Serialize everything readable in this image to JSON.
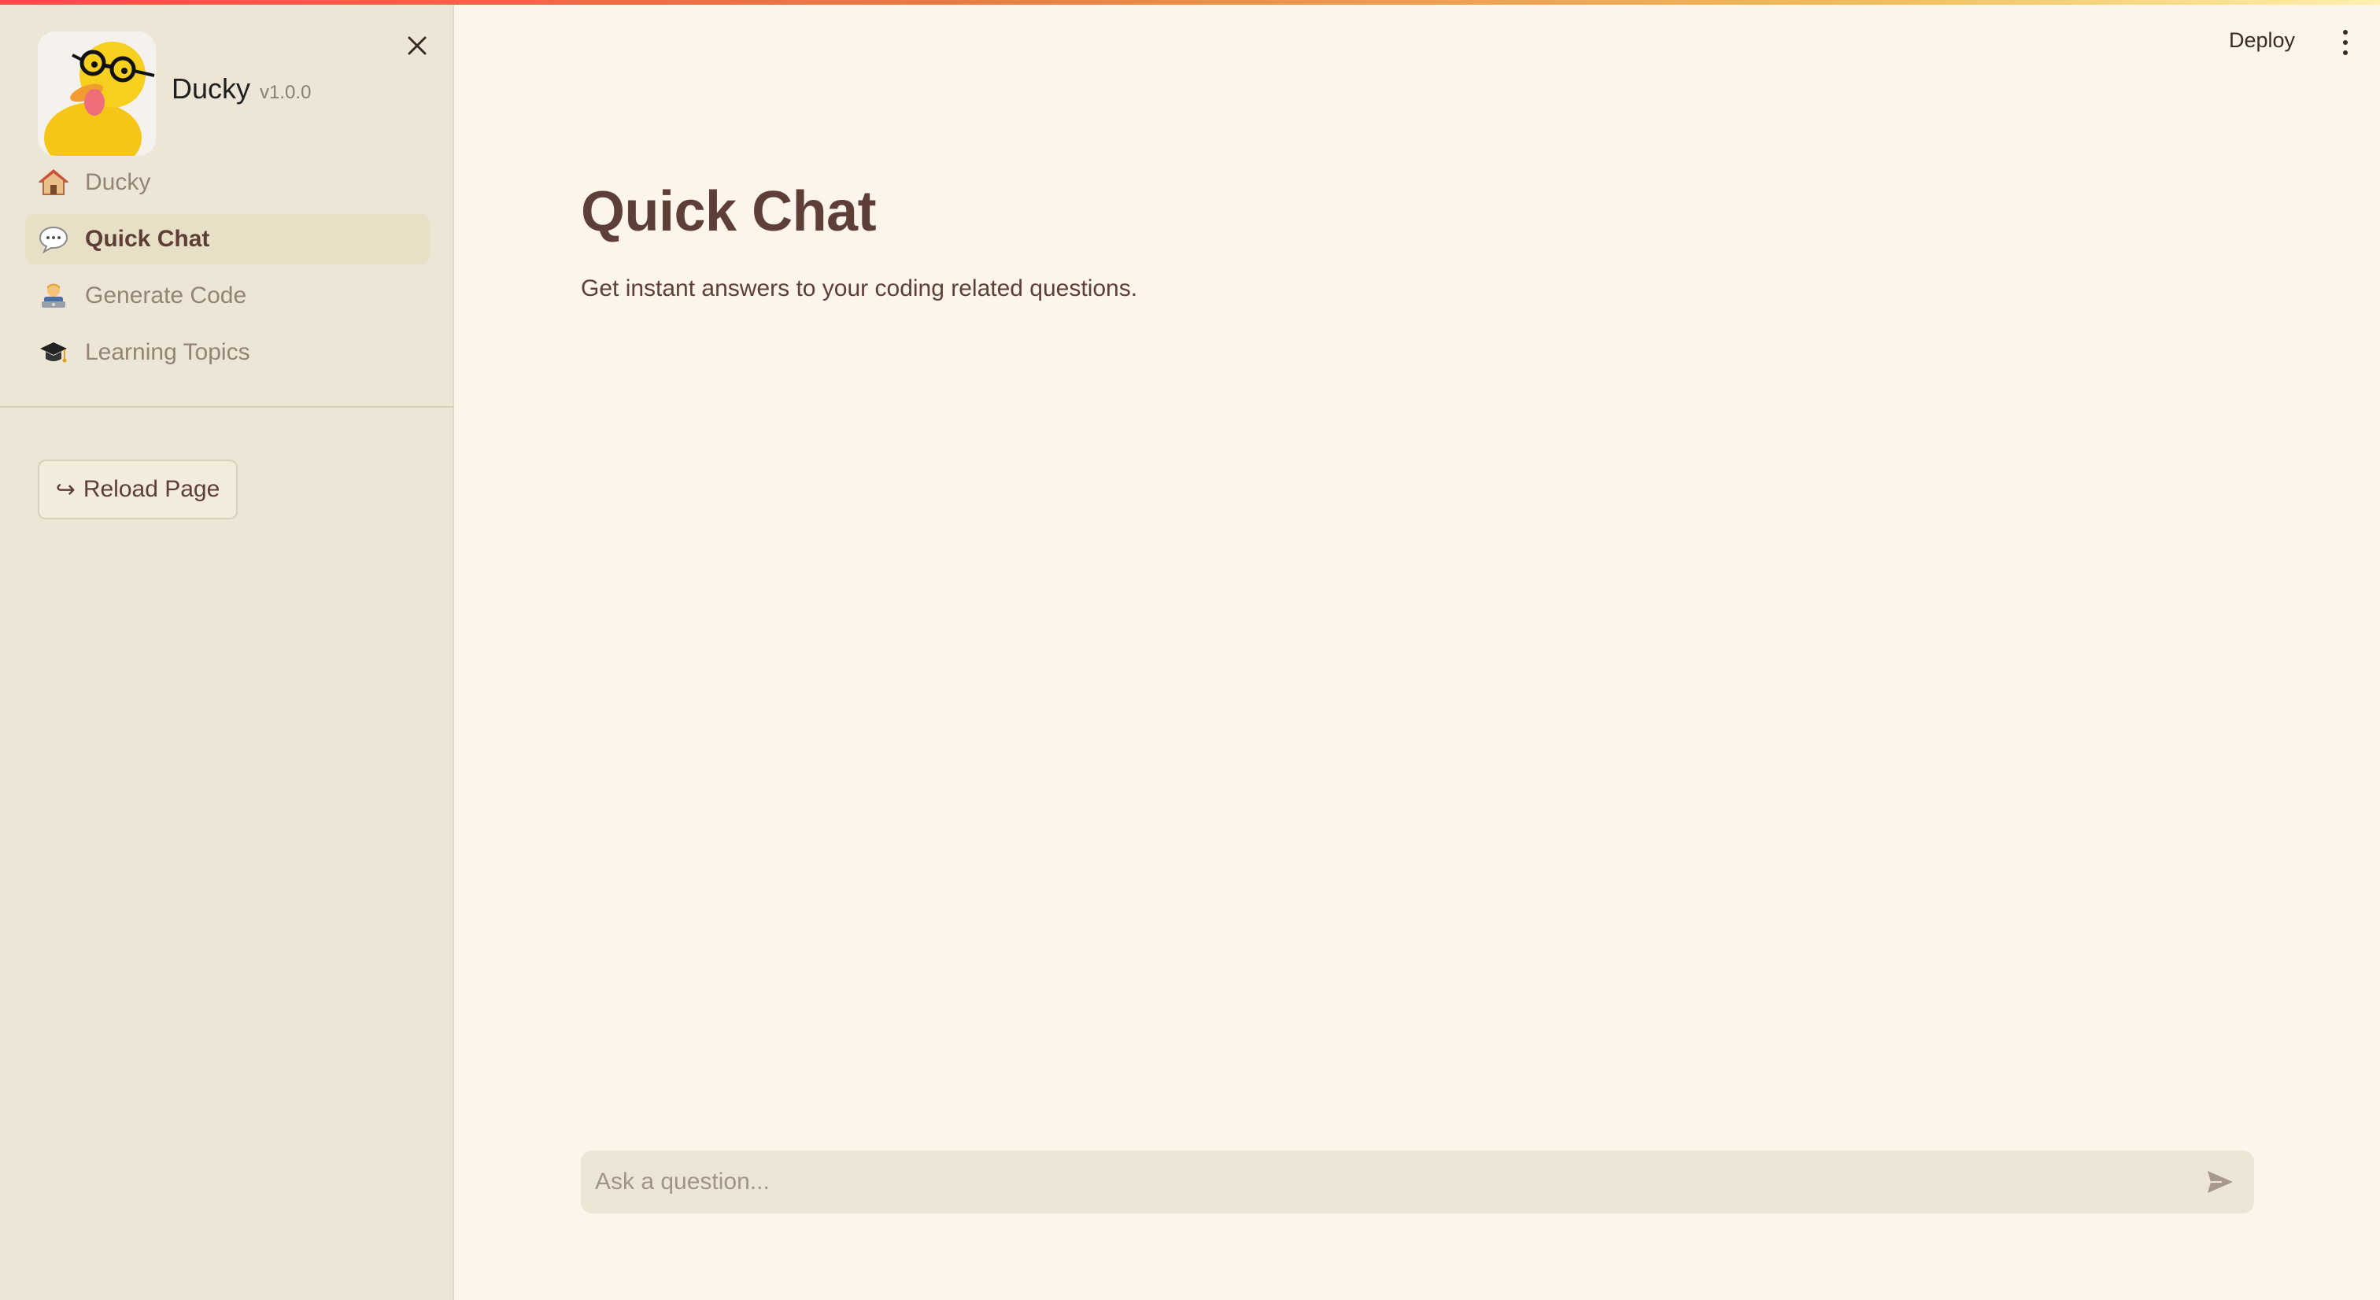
{
  "app": {
    "name": "Ducky",
    "version": "v1.0.0",
    "accent_color": "#ff4b4b",
    "background_color": "#fdf5ea",
    "sidebar_color": "#ede6d6",
    "text_color": "#5e3f37"
  },
  "sidebar": {
    "close_icon": "close-icon",
    "logo_icon": "duck-with-glasses-logo",
    "items": [
      {
        "label": "Ducky",
        "icon": "house-icon",
        "active": false
      },
      {
        "label": "Quick Chat",
        "icon": "speech-bubble-icon",
        "active": true
      },
      {
        "label": "Generate Code",
        "icon": "technologist-icon",
        "active": false
      },
      {
        "label": "Learning Topics",
        "icon": "graduation-cap-icon",
        "active": false
      }
    ],
    "reload_button": {
      "label": "Reload Page",
      "icon": "return-arrow-icon"
    }
  },
  "header": {
    "deploy_label": "Deploy",
    "menu_icon": "kebab-menu-icon"
  },
  "main": {
    "title": "Quick Chat",
    "subtitle": "Get instant answers to your coding related questions."
  },
  "chat_input": {
    "placeholder": "Ask a question...",
    "value": "",
    "send_icon": "send-icon"
  }
}
